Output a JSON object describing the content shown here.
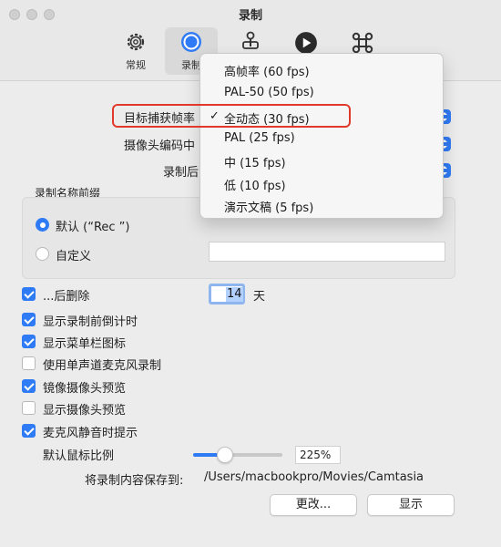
{
  "window": {
    "title": "录制"
  },
  "toolbar": {
    "tabs": [
      {
        "label": "常规",
        "icon": "gear-icon"
      },
      {
        "label": "录制",
        "icon": "record-icon",
        "active": true
      },
      {
        "label": "",
        "icon": "joystick-icon"
      },
      {
        "label": "",
        "icon": "play-icon"
      },
      {
        "label": "",
        "icon": "command-icon"
      }
    ]
  },
  "settings": {
    "capture_rate_label": "目标捕获帧率",
    "camera_encoding_label": "摄像头编码中",
    "after_recording_label": "录制后"
  },
  "prefix_group": {
    "title": "录制名称前缀",
    "default_option": "默认 (“Rec ”)",
    "custom_option": "自定义",
    "custom_value": ""
  },
  "delete_after": {
    "label": "...后删除",
    "value": "14",
    "unit": "天"
  },
  "checkboxes": [
    {
      "label": "显示录制前倒计时",
      "checked": true
    },
    {
      "label": "显示菜单栏图标",
      "checked": true
    },
    {
      "label": "使用单声道麦克风录制",
      "checked": false
    },
    {
      "label": "镜像摄像头预览",
      "checked": true
    },
    {
      "label": "显示摄像头预览",
      "checked": false
    },
    {
      "label": "麦克风静音时提示",
      "checked": true
    }
  ],
  "cursor_scale": {
    "label": "默认鼠标比例",
    "value_text": "225%",
    "slider_fraction": 0.3
  },
  "save_path": {
    "label": "将录制内容保存到:",
    "path": "/Users/macbookpro/Movies/Camtasia"
  },
  "buttons": {
    "change": "更改...",
    "show": "显示"
  },
  "dropdown": {
    "selected_index": 2,
    "checkmark": "✓",
    "options": [
      "高帧率 (60 fps)",
      "PAL-50 (50 fps)",
      "全动态 (30 fps)",
      "PAL (25 fps)",
      "中 (15 fps)",
      "低 (10 fps)",
      "演示文稿 (5 fps)"
    ]
  },
  "colors": {
    "accent": "#2f7bf5",
    "highlight_box": "#e13a2c"
  }
}
